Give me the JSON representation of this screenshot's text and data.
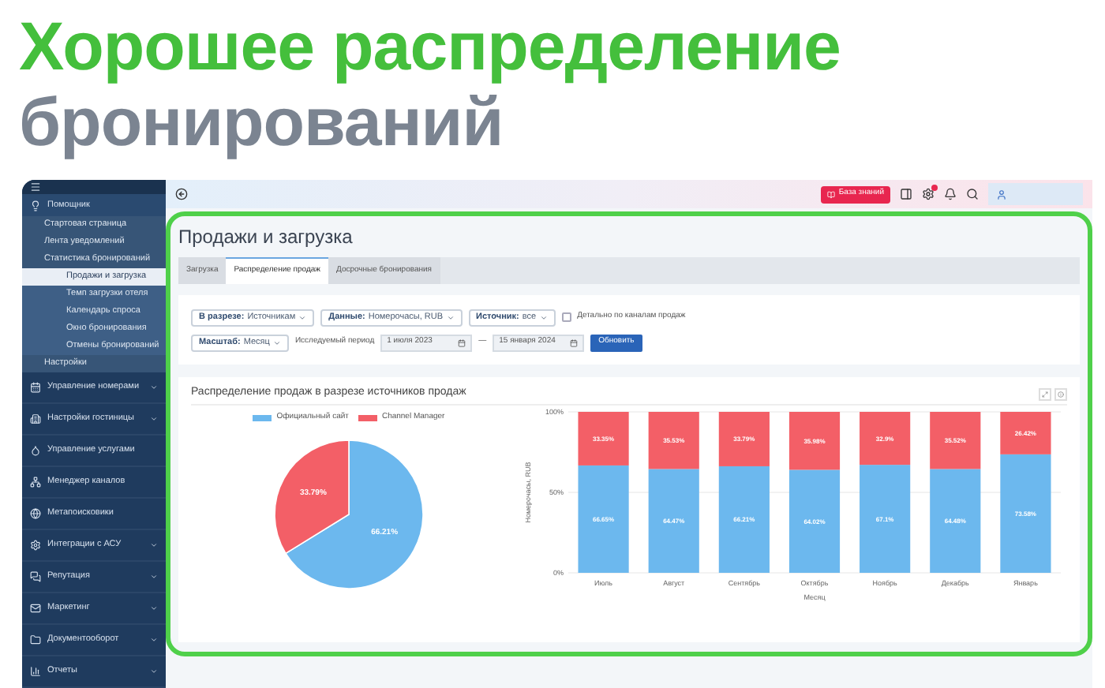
{
  "headline": {
    "line_1": "Хорошее распределение",
    "line_2": "бронирований"
  },
  "sidebar": {
    "items": [
      {
        "label": "Помощник",
        "submenu": false,
        "children": [
          {
            "label": "Стартовая страница",
            "selected": false
          },
          {
            "label": "Лента уведомлений",
            "selected": false
          },
          {
            "label": "Статистика бронирований",
            "selected": false,
            "children": [
              {
                "label": "Продажи и загрузка",
                "selected": true
              },
              {
                "label": "Темп загрузки отеля",
                "selected": false
              },
              {
                "label": "Календарь спроса",
                "selected": false
              },
              {
                "label": "Окно бронирования",
                "selected": false
              },
              {
                "label": "Отмены бронирований",
                "selected": false
              }
            ]
          },
          {
            "label": "Настройки",
            "selected": false
          }
        ]
      },
      {
        "label": "Управление номерами",
        "submenu": true
      },
      {
        "label": "Настройки гостиницы",
        "submenu": true
      },
      {
        "label": "Управление услугами",
        "submenu": false
      },
      {
        "label": "Менеджер каналов",
        "submenu": false
      },
      {
        "label": "Метапоисковики",
        "submenu": false
      },
      {
        "label": "Интеграции с АСУ",
        "submenu": true
      },
      {
        "label": "Репутация",
        "submenu": true
      },
      {
        "label": "Маркетинг",
        "submenu": true
      },
      {
        "label": "Документооборот",
        "submenu": true
      },
      {
        "label": "Отчеты",
        "submenu": true
      }
    ]
  },
  "topbar": {
    "knowledge_button": "База знаний",
    "notification_badge": true
  },
  "page": {
    "title": "Продажи и загрузка",
    "tabs": [
      {
        "label": "Загрузка",
        "selected": false
      },
      {
        "label": "Распределение продаж",
        "selected": true
      },
      {
        "label": "Досрочные бронирования",
        "selected": false
      }
    ],
    "filters": {
      "dropdowns": [
        {
          "label": "В разрезе:",
          "value": "Источникам"
        },
        {
          "label": "Данные:",
          "value": "Номерочасы, RUB"
        },
        {
          "label": "Источник:",
          "value": "все"
        }
      ],
      "detail_checkbox": {
        "label": "Детально по каналам продаж",
        "checked": false
      },
      "scale": {
        "label": "Масштаб:",
        "value": "Месяц"
      },
      "period_label": "Исследуемый период",
      "date_from": "1 июля 2023",
      "dash": "—",
      "date_to": "15 января 2024",
      "refresh_button": "Обновить"
    },
    "chart_panel": {
      "title": "Распределение продаж в разрезе источников продаж",
      "pie": {
        "chart_data": {
          "type": "pie",
          "categories": [
            "Официальный сайт",
            "Channel Manager"
          ],
          "values": [
            66.21,
            33.79
          ],
          "value_labels": [
            "66.21%",
            "33.79%"
          ]
        }
      },
      "bars": {
        "chart_data": {
          "type": "bar",
          "stacked": true,
          "ylabel": "Номерочасы, RUB",
          "xlabel": "Месяц",
          "categories": [
            "Июль",
            "Август",
            "Сентябрь",
            "Октябрь",
            "Ноябрь",
            "Декабрь",
            "Январь"
          ],
          "ylim": [
            0,
            100
          ],
          "yticks": [
            {
              "value": 0,
              "label": "0%"
            },
            {
              "value": 50,
              "label": "50%"
            },
            {
              "value": 100,
              "label": "100%"
            }
          ],
          "series": [
            {
              "color": "#6cb8ee",
              "values": [
                66.7,
                64.5,
                66.2,
                64.0,
                67.1,
                64.5,
                73.6
              ]
            },
            {
              "color": "#f35f67",
              "values": [
                33.3,
                35.5,
                33.8,
                36.0,
                32.9,
                35.5,
                26.4
              ]
            }
          ],
          "value_labels": [
            [
              "66.65%",
              "64.47%",
              "66.21%",
              "64.02%",
              "67.1%",
              "64.48%",
              "73.58%"
            ],
            [
              "33.35%",
              "35.53%",
              "33.79%",
              "35.98%",
              "32.9%",
              "35.52%",
              "26.42%"
            ]
          ]
        }
      }
    }
  }
}
